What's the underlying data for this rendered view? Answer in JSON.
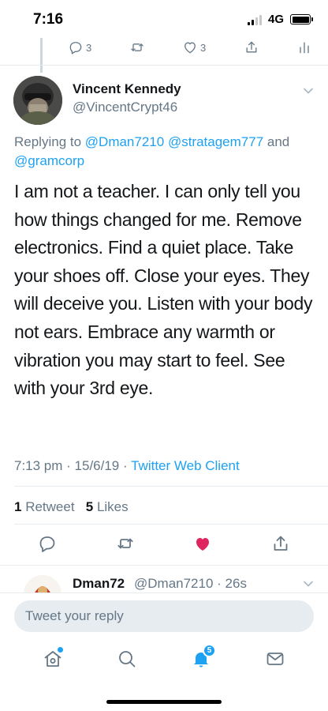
{
  "status_bar": {
    "time": "7:16",
    "network": "4G"
  },
  "previous_tweet": {
    "reply_count": "3",
    "like_count": "3"
  },
  "tweet": {
    "author_name": "Vincent Kennedy",
    "author_handle": "@VincentCrypt46",
    "replying_prefix": "Replying to ",
    "mention_1": "@Dman7210",
    "mention_2": "@stratagem777",
    "replying_and": " and ",
    "mention_3": "@gramcorp",
    "body": "I am not a teacher. I can only tell you how things changed for me. Remove electronics. Find a quiet place. Take your shoes off. Close your eyes. They will deceive you. Listen with your body not ears. Embrace any warmth or vibration you may start to feel. See with your 3rd eye.",
    "time": "7:13 pm",
    "date": "15/6/19",
    "client": "Twitter Web Client",
    "retweet_count": "1",
    "retweet_label": "Retweet",
    "like_count": "5",
    "like_label": "Likes",
    "liked": true
  },
  "next_reply": {
    "author_name": "Dman72",
    "author_handle": "@Dman7210",
    "age": "26s"
  },
  "compose": {
    "placeholder": "Tweet your reply"
  },
  "tabs": {
    "notification_badge": "5"
  },
  "colors": {
    "accent": "#1da1f2",
    "muted": "#657786",
    "like": "#e0245e"
  }
}
